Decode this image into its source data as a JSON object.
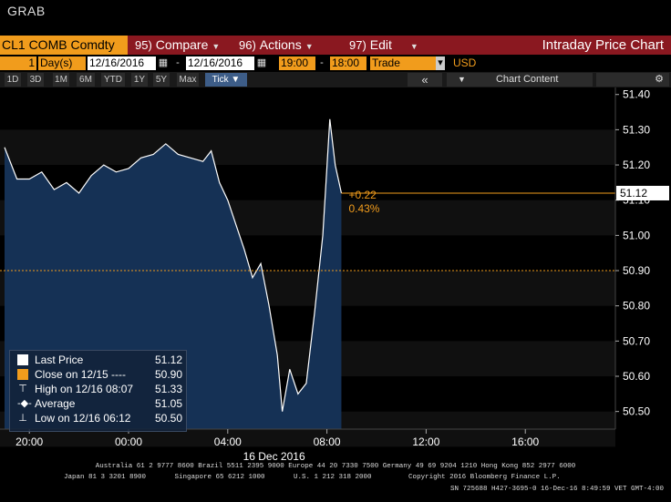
{
  "screen": {
    "title": "GRAB"
  },
  "toolbar": {
    "ticker": "CL1 COMB Comdty",
    "compare": {
      "num": "95)",
      "label": "Compare"
    },
    "actions": {
      "num": "96)",
      "label": "Actions"
    },
    "edit": {
      "num": "97)",
      "label": "Edit"
    },
    "title": "Intraday Price Chart"
  },
  "params": {
    "period_count": "1",
    "period_unit": "Day(s)",
    "start_date": "12/16/2016",
    "end_date": "12/16/2016",
    "start_time": "19:00",
    "end_time": "18:00",
    "market": "Trade",
    "currency": "USD"
  },
  "ranges": [
    "1D",
    "3D",
    "1M",
    "6M",
    "YTD",
    "1Y",
    "5Y",
    "Max",
    "Tick ▼"
  ],
  "chart_controls": {
    "collapse_label": "«",
    "chart_content_label": "Chart Content",
    "settings_icon": "gear-icon"
  },
  "chart_data": {
    "type": "area",
    "title": "Intraday Price Chart",
    "ylim": [
      50.45,
      51.42
    ],
    "yticks": [
      "51.40",
      "51.30",
      "51.20",
      "51.10",
      "51.00",
      "50.90",
      "50.80",
      "50.70",
      "50.60",
      "50.50"
    ],
    "xticks": [
      "20:00",
      "00:00",
      "04:00",
      "08:00",
      "12:00",
      "16:00"
    ],
    "date_label": "16 Dec 2016",
    "last_price": 51.12,
    "prev_close": 50.9,
    "change": "+0.22",
    "change_pct": "0.43%",
    "series": [
      {
        "name": "Last Price",
        "x": [
          "19:00",
          "19:30",
          "20:00",
          "20:30",
          "21:00",
          "21:30",
          "22:00",
          "22:30",
          "23:00",
          "23:30",
          "00:00",
          "00:30",
          "01:00",
          "01:30",
          "02:00",
          "02:30",
          "03:00",
          "03:20",
          "03:40",
          "04:00",
          "04:20",
          "04:40",
          "05:00",
          "05:20",
          "05:40",
          "06:00",
          "06:12",
          "06:30",
          "06:50",
          "07:10",
          "07:30",
          "07:50",
          "08:07",
          "08:20",
          "08:35"
        ],
        "y": [
          51.25,
          51.16,
          51.16,
          51.18,
          51.13,
          51.15,
          51.12,
          51.17,
          51.2,
          51.18,
          51.19,
          51.22,
          51.23,
          51.26,
          51.23,
          51.22,
          51.21,
          51.24,
          51.15,
          51.1,
          51.03,
          50.96,
          50.88,
          50.92,
          50.8,
          50.66,
          50.5,
          50.62,
          50.55,
          50.58,
          50.78,
          51.0,
          51.33,
          51.2,
          51.12
        ]
      }
    ]
  },
  "legend": [
    {
      "label": "Last Price",
      "value": "51.12",
      "icon": "square-white"
    },
    {
      "label": "Close on 12/15  ----",
      "value": "50.90",
      "icon": "square-orange"
    },
    {
      "label": "High on 12/16 08:07",
      "value": "51.33",
      "icon": "high-marker"
    },
    {
      "label": "Average",
      "value": "51.05",
      "icon": "average-marker"
    },
    {
      "label": "Low on 12/16 06:12",
      "value": "50.50",
      "icon": "low-marker"
    }
  ],
  "footer": {
    "line1": "Australia 61 2 9777 8600 Brazil 5511 2395 9000 Europe 44 20 7330 7500 Germany 49 69 9204 1210 Hong Kong 852 2977 6000",
    "line2": "Japan 81 3 3201 8900       Singapore 65 6212 1000       U.S. 1 212 318 2000         Copyright 2016 Bloomberg Finance L.P.",
    "line3": "SN 725688 H427-3695-0 16-Dec-16   8:49:59 VET  GMT-4:00"
  }
}
